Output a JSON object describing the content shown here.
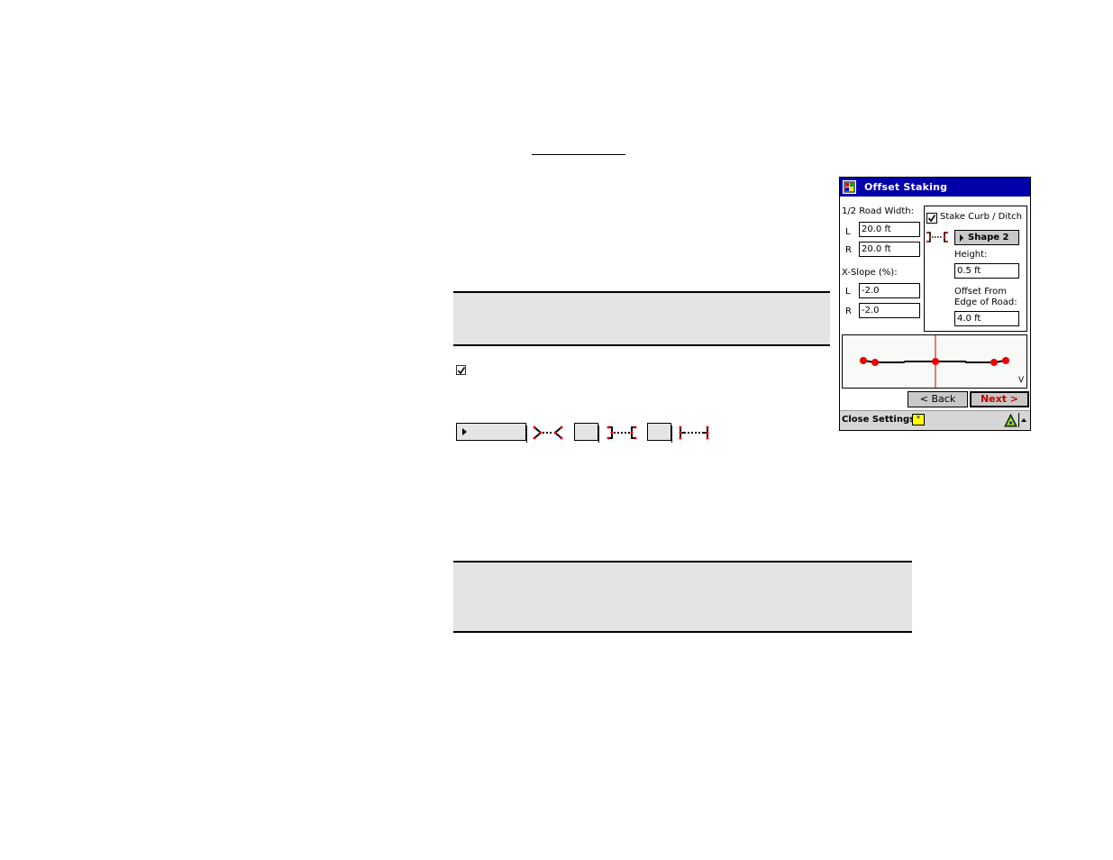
{
  "document": {
    "underline_rule": "",
    "section_checkbox": {
      "checked": true
    },
    "shape_selector": {
      "value": "",
      "shapes": [
        {
          "name": "shape-1",
          "icon": "v-ditch-icon"
        },
        {
          "name": "shape-2",
          "icon": "curb-bracket-icon"
        },
        {
          "name": "shape-3",
          "icon": "flat-tee-icon"
        }
      ]
    },
    "note_box_1": "",
    "note_box_2": ""
  },
  "device": {
    "title": "Offset Staking",
    "app_icon": "windows-flag-icon",
    "road_width": {
      "label": "1/2 Road Width:",
      "left_label": "L",
      "left_value": "20.0 ft",
      "right_label": "R",
      "right_value": "20.0 ft"
    },
    "xslope": {
      "label": "X-Slope (%):",
      "left_label": "L",
      "left_value": "-2.0",
      "right_label": "R",
      "right_value": "-2.0"
    },
    "curb": {
      "checkbox_label": "Stake Curb / Ditch",
      "checked": true,
      "shape_button": "Shape 2",
      "height_label": "Height:",
      "height_value": "0.5 ft",
      "offset_label_1": "Offset From",
      "offset_label_2": "Edge of Road:",
      "offset_value": "4.0 ft"
    },
    "diagram": {
      "corner_label": "V",
      "colors": {
        "centerline": "#cc0000",
        "point": "#ee0000",
        "road": "#000000"
      }
    },
    "buttons": {
      "back": "< Back",
      "next": "Next >"
    },
    "bottom": {
      "close_label": "Close Settings",
      "keyboard_icon": "*"
    }
  }
}
